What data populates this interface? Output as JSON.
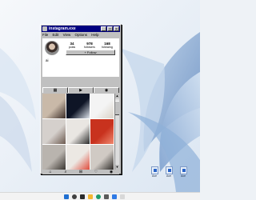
{
  "window": {
    "title": "instagram.exe",
    "controls": {
      "minimize": "_",
      "maximize": "□",
      "close": "×"
    }
  },
  "menu": [
    "File",
    "Edit",
    "View",
    "Options",
    "Help"
  ],
  "profile": {
    "stats": [
      {
        "value": "34",
        "label": "posts"
      },
      {
        "value": "978",
        "label": "followers"
      },
      {
        "value": "168",
        "label": "following"
      }
    ],
    "follow_button": "+ Follow",
    "username": "ai"
  },
  "tabs": [
    {
      "icon": "grid-icon",
      "glyph": "▦"
    },
    {
      "icon": "reels-icon",
      "glyph": "▶"
    },
    {
      "icon": "tagged-icon",
      "glyph": "◉"
    }
  ],
  "bottom_nav": [
    {
      "icon": "home-icon",
      "glyph": "⌂"
    },
    {
      "icon": "search-icon",
      "glyph": "⌕"
    },
    {
      "icon": "add-post-icon",
      "glyph": "⊞"
    },
    {
      "icon": "activity-icon",
      "glyph": "♡"
    },
    {
      "icon": "profile-icon",
      "glyph": "◉"
    }
  ],
  "grid_photos": [
    {
      "color": "#c9b9a8",
      "accent": "#3b2d28"
    },
    {
      "color": "#0e1526",
      "accent": "#e0e6ee"
    },
    {
      "color": "#f4f4f4",
      "accent": "#d9d2c8"
    },
    {
      "color": "#d5d0cc",
      "accent": "#6c5a4f"
    },
    {
      "color": "#e9e6e2",
      "accent": "#2a2a2a"
    },
    {
      "color": "#c8321e",
      "accent": "#f08a70"
    },
    {
      "color": "#b9b4ae",
      "accent": "#3a3530"
    },
    {
      "color": "#ece8e3",
      "accent": "#e04a3a"
    },
    {
      "color": "#d0cac4",
      "accent": "#2e2b28"
    }
  ],
  "desktop_icons": [
    "Ace",
    "Ace",
    "Ace"
  ],
  "taskbar_icons": [
    "start-icon",
    "search-icon",
    "taskview-icon",
    "files-icon",
    "edge-icon",
    "store-icon",
    "mail-icon",
    "music-icon"
  ],
  "colors": {
    "titlebar": "#000080",
    "window_face": "#c0c0c0",
    "desktop": "#eef2f6",
    "accent": "#2a64c8"
  }
}
